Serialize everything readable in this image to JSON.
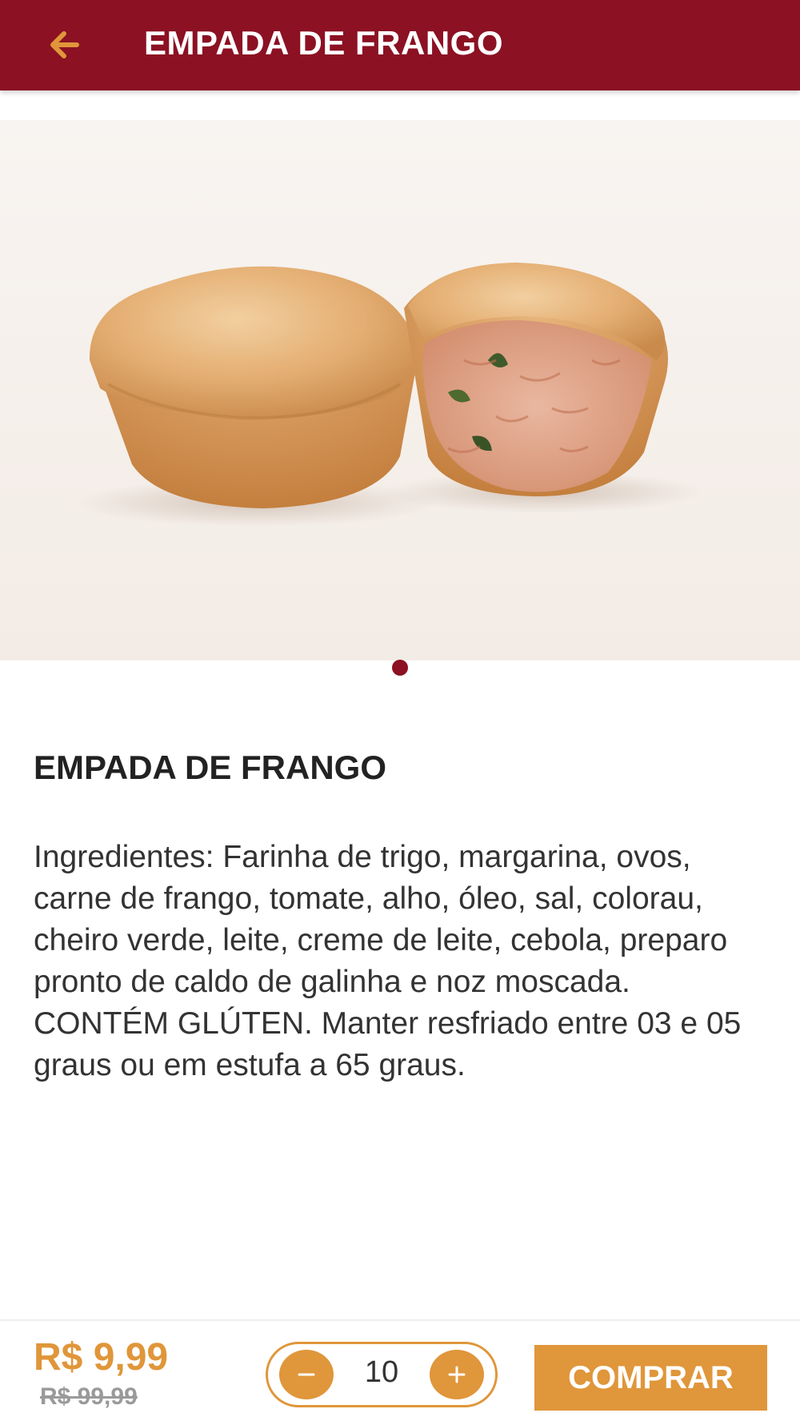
{
  "header": {
    "title": "EMPADA DE FRANGO",
    "back_icon": "arrow-left-icon"
  },
  "carousel": {
    "image_subject": "chicken-empada-photo",
    "page_count": 1,
    "active_index": 0
  },
  "product": {
    "name": "EMPADA DE FRANGO",
    "description": "Ingredientes: Farinha de trigo, margarina, ovos, carne de frango, tomate, alho, óleo, sal, colorau, cheiro verde, leite, creme de leite, cebola, preparo pronto de caldo de galinha e noz moscada.  CONTÉM GLÚTEN.  Manter resfriado entre 03 e 05 graus ou em estufa a 65 graus."
  },
  "purchase": {
    "price": "R$ 9,99",
    "old_price": "R$ 99,99",
    "quantity": "10",
    "buy_label": "COMPRAR",
    "minus_icon": "minus-icon",
    "plus_icon": "plus-icon"
  },
  "colors": {
    "header_bg": "#8b1123",
    "accent": "#e0963a",
    "dot_active": "#8b1123"
  }
}
